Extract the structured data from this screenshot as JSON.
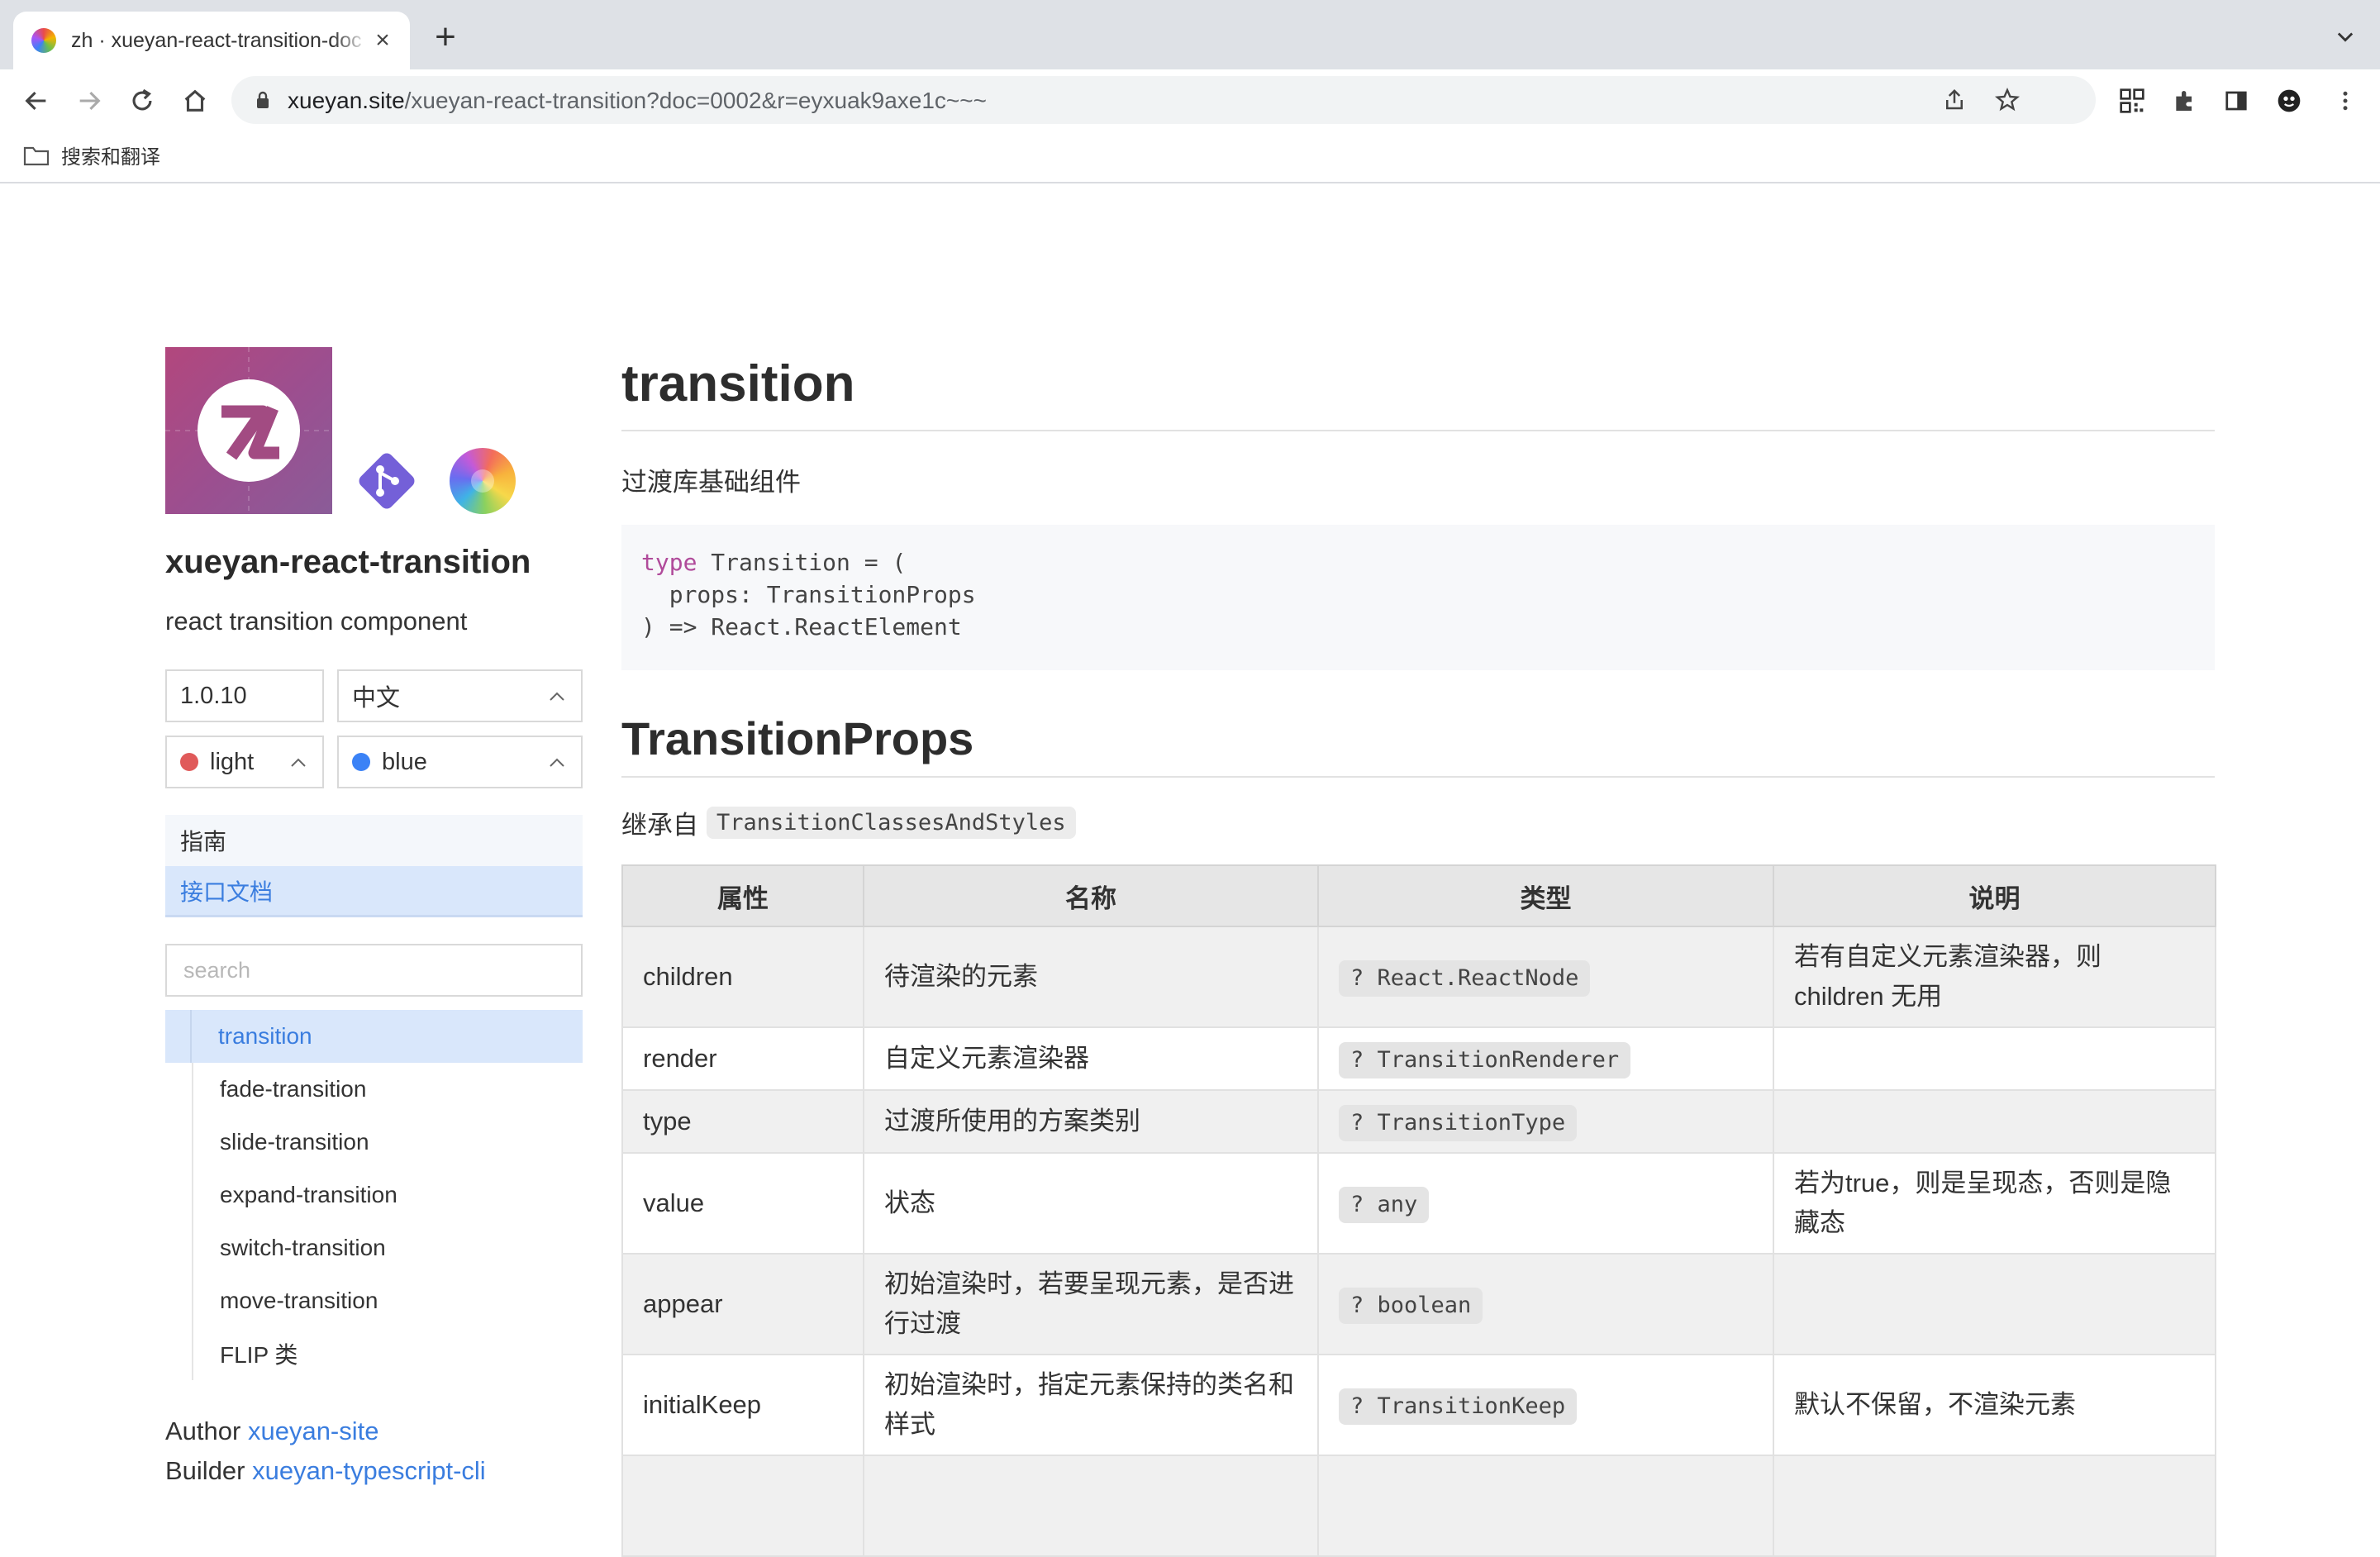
{
  "browser": {
    "tab_title": "zh · xueyan-react-transition-doc",
    "url_host": "xueyan.site",
    "url_path": "/xueyan-react-transition?doc=0002&r=eyxuak9axe1c~~~",
    "bookmark_label": "搜索和翻译"
  },
  "sidebar": {
    "package_name": "xueyan-react-transition",
    "package_desc": "react transition component",
    "version": "1.0.10",
    "language": "中文",
    "theme": "light",
    "theme_color": "#e05a5a",
    "accent": "blue",
    "accent_color": "#3b82f6",
    "nav": [
      "指南",
      "接口文档"
    ],
    "search_placeholder": "search",
    "docs": [
      "transition",
      "fade-transition",
      "slide-transition",
      "expand-transition",
      "switch-transition",
      "move-transition",
      "FLIP 类"
    ],
    "author_label": "Author",
    "author": "xueyan-site",
    "builder_label": "Builder",
    "builder": "xueyan-typescript-cli"
  },
  "main": {
    "title": "transition",
    "lead": "过渡库基础组件",
    "code": {
      "kw": "type",
      "line1_rest": " Transition = (",
      "line2": "  props: TransitionProps",
      "line3": ") => React.ReactElement"
    },
    "section_title": "TransitionProps",
    "inherit_label": "继承自",
    "inherit_type": "TransitionClassesAndStyles",
    "table": {
      "headers": [
        "属性",
        "名称",
        "类型",
        "说明"
      ],
      "rows": [
        {
          "prop": "children",
          "name": "待渲染的元素",
          "type": "? React.ReactNode",
          "desc": "若有自定义元素渲染器，则 children 无用"
        },
        {
          "prop": "render",
          "name": "自定义元素渲染器",
          "type": "? TransitionRenderer",
          "desc": ""
        },
        {
          "prop": "type",
          "name": "过渡所使用的方案类别",
          "type": "? TransitionType",
          "desc": ""
        },
        {
          "prop": "value",
          "name": "状态",
          "type": "? any",
          "desc": "若为true，则是呈现态，否则是隐藏态"
        },
        {
          "prop": "appear",
          "name": "初始渲染时，若要呈现元素，是否进行过渡",
          "type": "? boolean",
          "desc": ""
        },
        {
          "prop": "initialKeep",
          "name": "初始渲染时，指定元素保持的类名和样式",
          "type": "? TransitionKeep",
          "desc": "默认不保留，不渲染元素"
        }
      ]
    }
  }
}
